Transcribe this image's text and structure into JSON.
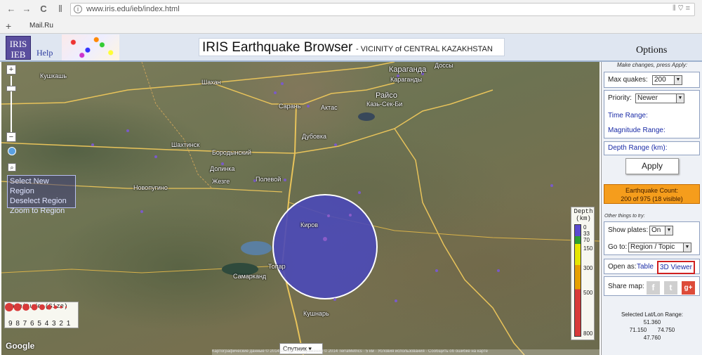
{
  "browser": {
    "url": "www.iris.edu/ieb/index.html",
    "bookmark": "Mail.Ru",
    "new_tab": "+",
    "nav_back": "←",
    "nav_forward": "→",
    "nav_reload": "C",
    "url_icon": "i",
    "url_right": "⦀ ♡ ≡"
  },
  "header": {
    "logo_text": "IRIS IEB",
    "help": "Help",
    "title": "IRIS Earthquake Browser",
    "subtitle": "- VICINITY of CENTRAL KAZAKHSTAN",
    "options": "Options"
  },
  "map": {
    "labels": [
      "Караганда",
      "Караганды",
      "Шахан",
      "Сарань",
      "Актас",
      "Райсо",
      "Казь-Сек-Би",
      "Шахтинск",
      "Дубовка",
      "Бородынский",
      "Долинка",
      "Новопугино",
      "Жезге",
      "Полевой",
      "Топар",
      "Самарканд",
      "Кушнарь",
      "Доссы",
      "Кушкашь",
      "Киров"
    ],
    "region_menu": [
      "Select New Region",
      "Deselect Region",
      "Zoom to Region"
    ],
    "magnitude_legend": {
      "title": "Magnitude (Size)",
      "numbers": "9 8 7 6 5 4 3 2 1"
    },
    "depth_legend": {
      "title": "Depth (km)",
      "ticks": [
        "0",
        "33",
        "70",
        "150",
        "300",
        "500",
        "800"
      ]
    },
    "google": "Google",
    "map_button": "Спутник ▾",
    "copyright": "Картографические данные © 2014 Google, Изображения © 2014 TerraMetrics · 5 км · Условия использования · Сообщить об ошибке на карте",
    "zoom_in": "+",
    "zoom_out": "−",
    "mag_icon": "⌕"
  },
  "panel": {
    "hint": "Make changes, press Apply:",
    "max_quakes_label": "Max quakes:",
    "max_quakes_value": "200",
    "priority_label": "Priority:",
    "priority_value": "Newer",
    "time_range": "Time Range:",
    "magnitude_range": "Magnitude Range:",
    "depth_range": "Depth Range (km):",
    "apply": "Apply",
    "count_line1": "Earthquake Count:",
    "count_line2": "200 of 975 (18 visible)",
    "other": "Other things to try:",
    "show_plates_label": "Show plates:",
    "show_plates_value": "On",
    "goto_label": "Go to:",
    "goto_value": "Region / Topic",
    "open_as_label": "Open as:",
    "open_table": "Table",
    "open_3d": "3D Viewer",
    "share_label": "Share map:",
    "share_f": "f",
    "share_t": "t",
    "share_g": "g+",
    "latlon_title": "Selected Lat/Lon Range:",
    "lat_max": "51.360",
    "lon_min": "71.150",
    "lon_max": "74.750",
    "lat_min": "47.760"
  },
  "colors": {
    "circle": "#4b49b8",
    "orange": "#f59d1c",
    "link": "#1a2ba6"
  }
}
